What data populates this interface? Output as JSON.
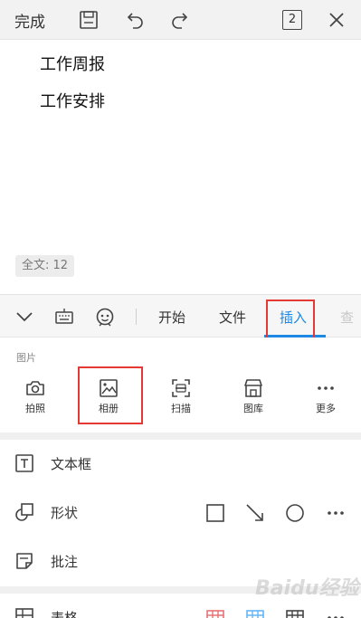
{
  "topbar": {
    "done_label": "完成",
    "page_count": "2"
  },
  "document": {
    "lines": [
      "工作周报",
      "工作安排"
    ],
    "word_count": "全文: 12"
  },
  "tabbar": {
    "tabs": [
      "开始",
      "文件",
      "插入",
      "查"
    ]
  },
  "pictures": {
    "section_title": "图片",
    "items": [
      {
        "label": "拍照",
        "icon": "camera-icon"
      },
      {
        "label": "相册",
        "icon": "image-icon"
      },
      {
        "label": "扫描",
        "icon": "scan-icon"
      },
      {
        "label": "图库",
        "icon": "store-icon"
      },
      {
        "label": "更多",
        "icon": "more-icon"
      }
    ]
  },
  "rows": {
    "textbox": "文本框",
    "shape": "形状",
    "comment": "批注",
    "table": "表格"
  },
  "watermark": "Baidu经验",
  "colors": {
    "accent": "#1e88e5",
    "highlight": "#e53935"
  }
}
